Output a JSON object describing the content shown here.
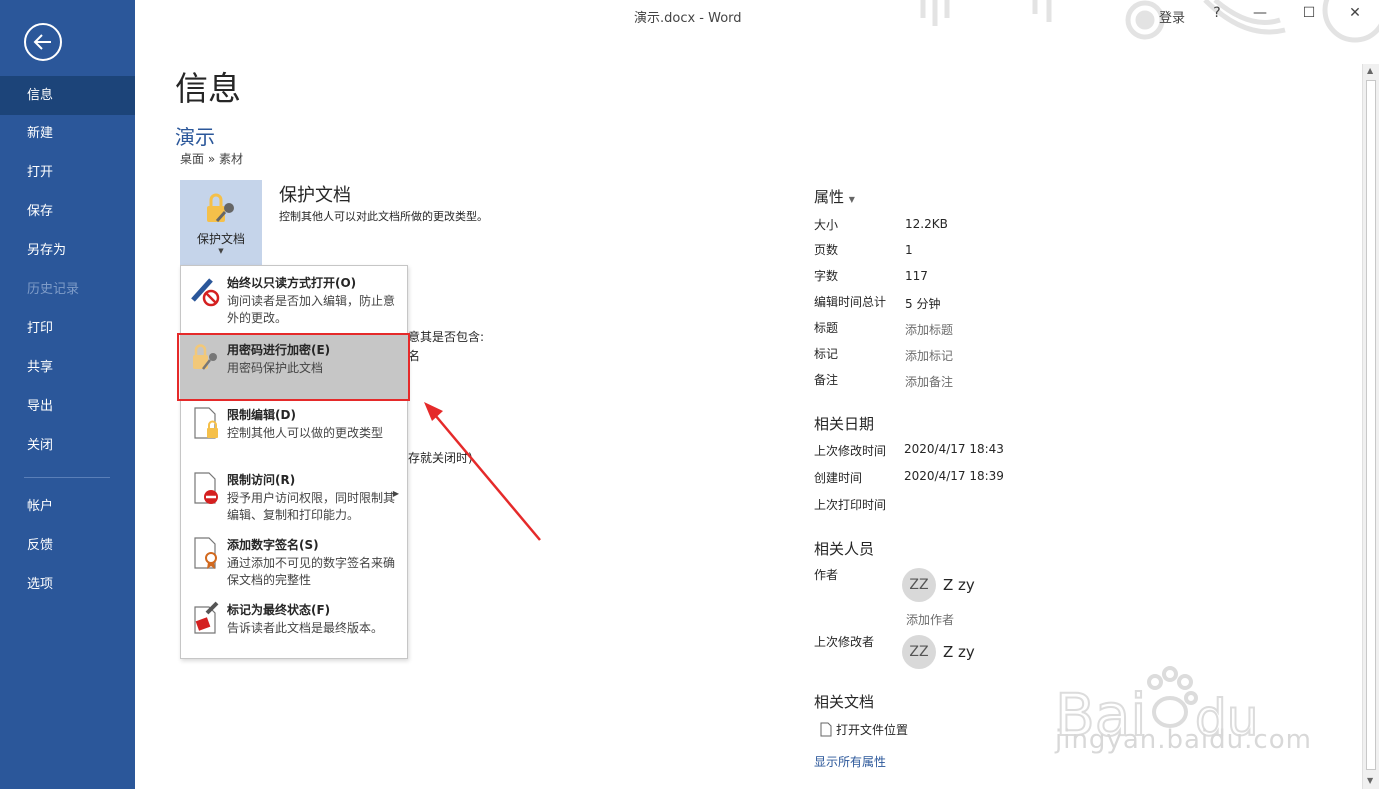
{
  "window": {
    "title": "演示.docx  -  Word",
    "login": "登录",
    "help": "?",
    "minimize": "—",
    "maximize": "☐",
    "close": "✕"
  },
  "sidebar": {
    "items": [
      {
        "label": "信息"
      },
      {
        "label": "新建"
      },
      {
        "label": "打开"
      },
      {
        "label": "保存"
      },
      {
        "label": "另存为"
      },
      {
        "label": "历史记录"
      },
      {
        "label": "打印"
      },
      {
        "label": "共享"
      },
      {
        "label": "导出"
      },
      {
        "label": "关闭"
      },
      {
        "label": "帐户"
      },
      {
        "label": "反馈"
      },
      {
        "label": "选项"
      }
    ]
  },
  "main": {
    "title": "信息",
    "doc_name": "演示",
    "doc_path": "桌面 » 素材",
    "protect": {
      "button_label": "保护文档",
      "title": "保护文档",
      "desc": "控制其他人可以对此文档所做的更改类型。"
    },
    "bg_text": [
      "意其是否包含:",
      "名",
      "存就关闭时)"
    ]
  },
  "menu": {
    "items": [
      {
        "title": "始终以只读方式打开(O)",
        "desc": "询问读者是否加入编辑，防止意外的更改。"
      },
      {
        "title": "用密码进行加密(E)",
        "desc": "用密码保护此文档"
      },
      {
        "title": "限制编辑(D)",
        "desc": "控制其他人可以做的更改类型"
      },
      {
        "title": "限制访问(R)",
        "desc": "授予用户访问权限，同时限制其编辑、复制和打印能力。"
      },
      {
        "title": "添加数字签名(S)",
        "desc": "通过添加不可见的数字签名来确保文档的完整性"
      },
      {
        "title": "标记为最终状态(F)",
        "desc": "告诉读者此文档是最终版本。"
      }
    ]
  },
  "properties": {
    "title": "属性",
    "rows": [
      {
        "label": "大小",
        "value": "12.2KB"
      },
      {
        "label": "页数",
        "value": "1"
      },
      {
        "label": "字数",
        "value": "117"
      },
      {
        "label": "编辑时间总计",
        "value": "5 分钟"
      },
      {
        "label": "标题",
        "value": "添加标题"
      },
      {
        "label": "标记",
        "value": "添加标记"
      },
      {
        "label": "备注",
        "value": "添加备注"
      }
    ]
  },
  "dates": {
    "title": "相关日期",
    "rows": [
      {
        "label": "上次修改时间",
        "value": "2020/4/17 18:43"
      },
      {
        "label": "创建时间",
        "value": "2020/4/17 18:39"
      },
      {
        "label": "上次打印时间",
        "value": ""
      }
    ]
  },
  "people": {
    "title": "相关人员",
    "author_label": "作者",
    "author_initials": "ZZ",
    "author_name": "Z zy",
    "add_author": "添加作者",
    "last_modified_label": "上次修改者",
    "modifier_initials": "ZZ",
    "modifier_name": "Z zy"
  },
  "related_docs": {
    "title": "相关文档",
    "open_location": "打开文件位置",
    "show_all": "显示所有属性"
  },
  "watermark": {
    "text": "jingyan.baidu.com"
  },
  "colors": {
    "sidebar": "#2b579a",
    "sidebar_active": "#1c4479",
    "accent": "#2b579a",
    "highlight": "#c6c6c6",
    "annotation": "#e52a2a"
  }
}
